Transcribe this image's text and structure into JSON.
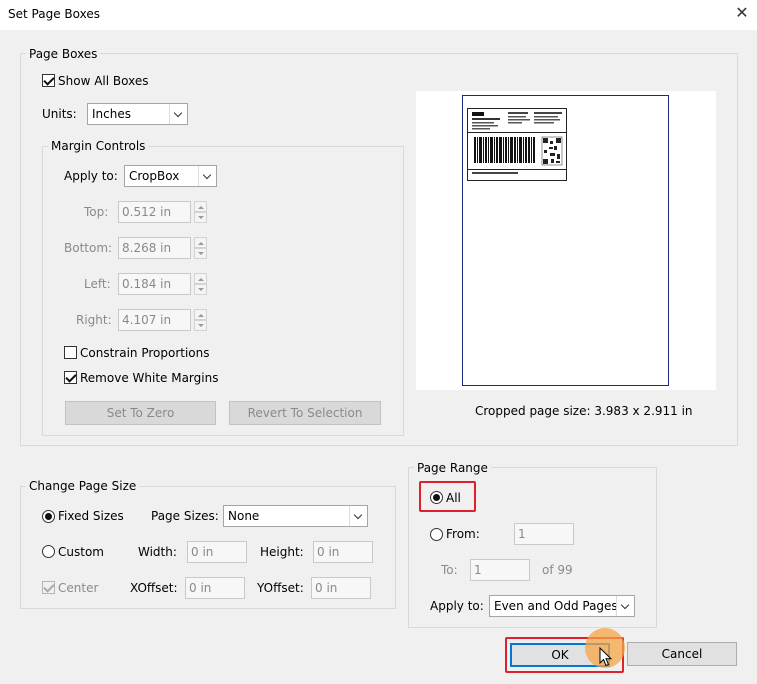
{
  "window": {
    "title": "Set Page Boxes",
    "close_glyph": "✕"
  },
  "page_boxes": {
    "label": "Page Boxes",
    "show_all_boxes": {
      "label": "Show All Boxes",
      "checked": true
    },
    "units": {
      "label": "Units:",
      "value": "Inches"
    },
    "margin_controls": {
      "label": "Margin Controls",
      "apply_to": {
        "label": "Apply to:",
        "value": "CropBox"
      },
      "top": {
        "label": "Top:",
        "value": "0.512 in"
      },
      "bottom": {
        "label": "Bottom:",
        "value": "8.268 in"
      },
      "left": {
        "label": "Left:",
        "value": "0.184 in"
      },
      "right": {
        "label": "Right:",
        "value": "4.107 in"
      },
      "constrain": {
        "label": "Constrain Proportions",
        "checked": false
      },
      "remove_white": {
        "label": "Remove White Margins",
        "checked": true
      },
      "set_to_zero": "Set To Zero",
      "revert": "Revert To Selection"
    },
    "cropped_size": "Cropped page size: 3.983 x 2.911 in"
  },
  "change_page_size": {
    "label": "Change Page Size",
    "fixed_sizes": {
      "label": "Fixed Sizes",
      "selected": true
    },
    "page_sizes": {
      "label": "Page Sizes:",
      "value": "None"
    },
    "custom": {
      "label": "Custom",
      "selected": false
    },
    "width": {
      "label": "Width:",
      "value": "0 in"
    },
    "height": {
      "label": "Height:",
      "value": "0 in"
    },
    "center": {
      "label": "Center",
      "checked": true
    },
    "xoffset": {
      "label": "XOffset:",
      "value": "0 in"
    },
    "yoffset": {
      "label": "YOffset:",
      "value": "0 in"
    }
  },
  "page_range": {
    "label": "Page Range",
    "all": {
      "label": "All",
      "selected": true
    },
    "from": {
      "label": "From:",
      "value": "1"
    },
    "to": {
      "label": "To:",
      "value": "1"
    },
    "of": "of 99",
    "apply_to": {
      "label": "Apply to:",
      "value": "Even and Odd Pages"
    }
  },
  "buttons": {
    "ok": "OK",
    "cancel": "Cancel"
  },
  "colors": {
    "highlight": "#e0202a",
    "focus": "#0078d7",
    "cursor_glow": "#f5a546"
  }
}
